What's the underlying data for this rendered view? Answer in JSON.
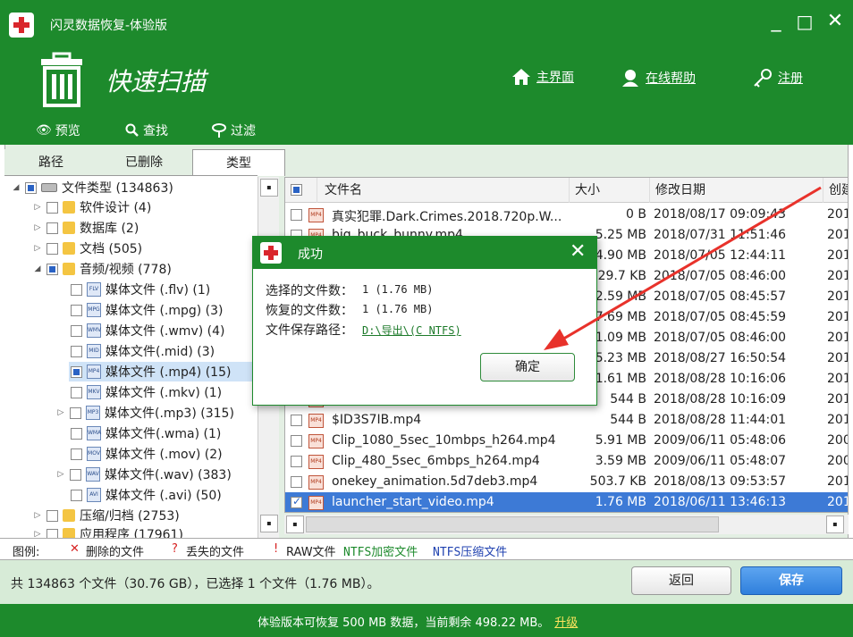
{
  "app": {
    "title": "闪灵数据恢复-体验版",
    "minimize": "_",
    "maximize": "□",
    "close": "✕"
  },
  "header": {
    "scan_title": "快速扫描",
    "nav": [
      {
        "label": "主界面",
        "icon": "home-icon"
      },
      {
        "label": "在线帮助",
        "icon": "help-person-icon"
      },
      {
        "label": "注册",
        "icon": "key-icon"
      }
    ]
  },
  "toolbar": {
    "preview": "预览",
    "find": "查找",
    "filter": "过滤"
  },
  "tabs": [
    "路径",
    "已删除",
    "类型"
  ],
  "tree": [
    {
      "label": "文件类型 (134863)",
      "icon": "drive",
      "expanded": true,
      "check": "part"
    },
    {
      "label": "软件设计 (4)",
      "icon": "folder"
    },
    {
      "label": "数据库 (2)",
      "icon": "folder"
    },
    {
      "label": "文档 (505)",
      "icon": "folder"
    },
    {
      "label": "音频/视频 (778)",
      "icon": "folder",
      "expanded": true,
      "check": "part"
    },
    {
      "label": "媒体文件 (.flv) (1)",
      "tag": "FLV"
    },
    {
      "label": "媒体文件 (.mpg) (3)",
      "tag": "MPG"
    },
    {
      "label": "媒体文件 (.wmv) (4)",
      "tag": "WMV"
    },
    {
      "label": "媒体文件(.mid) (3)",
      "tag": "MID"
    },
    {
      "label": "媒体文件 (.mp4) (15)",
      "tag": "MP4",
      "selected": true,
      "check": "part"
    },
    {
      "label": "媒体文件 (.mkv) (1)",
      "tag": "MKV"
    },
    {
      "label": "媒体文件(.mp3) (315)",
      "tag": "MP3",
      "collapsible": true
    },
    {
      "label": "媒体文件(.wma) (1)",
      "tag": "WMA"
    },
    {
      "label": "媒体文件 (.mov) (2)",
      "tag": "MOV"
    },
    {
      "label": "媒体文件(.wav) (383)",
      "tag": "WAV",
      "collapsible": true
    },
    {
      "label": "媒体文件 (.avi) (50)",
      "tag": "AVI"
    },
    {
      "label": "压缩/归档 (2753)",
      "icon": "folder"
    },
    {
      "label": "应用程序 (17961)",
      "icon": "folder"
    }
  ],
  "list": {
    "columns": [
      "文件名",
      "大小",
      "修改日期",
      "创建"
    ],
    "rows": [
      {
        "name": "真实犯罪.Dark.Crimes.2018.720p.W...",
        "size": "0 B",
        "modified": "2018/08/17 09:09:43",
        "created": "201"
      },
      {
        "name": "big_buck_bunny.mp4",
        "size": "5.25 MB",
        "modified": "2018/07/31 11:51:46",
        "created": "201"
      },
      {
        "name": "",
        "size": "4.90 MB",
        "modified": "2018/07/05 12:44:11",
        "created": "201"
      },
      {
        "name": "",
        "size": "29.7 KB",
        "modified": "2018/07/05 08:46:00",
        "created": "201"
      },
      {
        "name": "",
        "size": "2.59 MB",
        "modified": "2018/07/05 08:45:57",
        "created": "201"
      },
      {
        "name": "",
        "size": "7.69 MB",
        "modified": "2018/07/05 08:45:59",
        "created": "201"
      },
      {
        "name": "",
        "size": "1.09 MB",
        "modified": "2018/07/05 08:46:00",
        "created": "201"
      },
      {
        "name": "",
        "size": "5.23 MB",
        "modified": "2018/08/27 16:50:54",
        "created": "201"
      },
      {
        "name": "",
        "size": "1.61 MB",
        "modified": "2018/08/28 10:16:06",
        "created": "201"
      },
      {
        "name": "",
        "size": "544 B",
        "modified": "2018/08/28 10:16:09",
        "created": "201"
      },
      {
        "name": "$ID3S7IB.mp4",
        "size": "544 B",
        "modified": "2018/08/28 11:44:01",
        "created": "201"
      },
      {
        "name": "Clip_1080_5sec_10mbps_h264.mp4",
        "size": "5.91 MB",
        "modified": "2009/06/11 05:48:06",
        "created": "200"
      },
      {
        "name": "Clip_480_5sec_6mbps_h264.mp4",
        "size": "3.59 MB",
        "modified": "2009/06/11 05:48:07",
        "created": "200"
      },
      {
        "name": "onekey_animation.5d7deb3.mp4",
        "size": "503.7 KB",
        "modified": "2018/08/13 09:53:57",
        "created": "201"
      },
      {
        "name": "launcher_start_video.mp4",
        "size": "1.76 MB",
        "modified": "2018/06/11 13:46:13",
        "created": "201",
        "selected": true
      }
    ]
  },
  "legend": {
    "title": "图例:",
    "deleted": "删除的文件",
    "lost": "丢失的文件",
    "raw": "RAW文件",
    "ntfs_enc": "NTFS加密文件",
    "ntfs_comp": "NTFS压缩文件"
  },
  "status": {
    "text": "共 134863 个文件（30.76 GB），已选择 1 个文件（1.76 MB）。",
    "back": "返回",
    "save": "保存"
  },
  "footer": {
    "text": "体验版本可恢复 500 MB 数据，当前剩余 498.22 MB。",
    "upgrade": "升级"
  },
  "dialog": {
    "title": "成功",
    "close": "✕",
    "selected_label": "选择的文件数：",
    "selected_value": "1 (1.76 MB)",
    "recovered_label": "恢复的文件数：",
    "recovered_value": "1 (1.76 MB)",
    "path_label": "文件保存路径：",
    "path_value": "D:\\导出\\(C NTFS)",
    "ok": "确定"
  },
  "colors": {
    "brand_green": "#1d8a2c",
    "selection_blue": "#3d7ad6",
    "annotation_red": "#e8322b"
  }
}
